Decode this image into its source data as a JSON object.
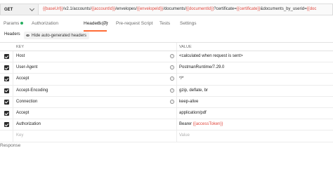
{
  "request": {
    "method": "GET",
    "url_parts": [
      {
        "text": "{{baseUrl}}",
        "var": true
      },
      {
        "text": "/v2.1/accounts/",
        "var": false
      },
      {
        "text": "{{accountId}}",
        "var": true
      },
      {
        "text": "/envelopes/",
        "var": false
      },
      {
        "text": "{{envelopeId}}",
        "var": true
      },
      {
        "text": "/documents/",
        "var": false
      },
      {
        "text": "{{documentId}}",
        "var": true
      },
      {
        "text": "?certificate=",
        "var": false
      },
      {
        "text": "{{certificate}}",
        "var": true
      },
      {
        "text": "&documents_by_userid=",
        "var": false
      },
      {
        "text": "{{doc",
        "var": true
      }
    ]
  },
  "tabs": [
    {
      "label": "Params",
      "dot": true
    },
    {
      "label": "Authorization"
    },
    {
      "label": "Headers (7)",
      "active": true
    },
    {
      "label": "Body"
    },
    {
      "label": "Pre-request Script"
    },
    {
      "label": "Tests"
    },
    {
      "label": "Settings"
    }
  ],
  "subbar": {
    "headers_label": "Headers",
    "hide_label": "Hide auto-generated headers"
  },
  "table": {
    "col_key": "KEY",
    "col_value": "VALUE",
    "rows": [
      {
        "key": "Host",
        "value_parts": [
          {
            "text": "<calculated when request is sent>"
          }
        ],
        "info": true
      },
      {
        "key": "User-Agent",
        "value_parts": [
          {
            "text": "PostmanRuntime/7.29.0"
          }
        ],
        "info": true
      },
      {
        "key": "Accept",
        "value_parts": [
          {
            "text": "*/*"
          }
        ],
        "info": true
      },
      {
        "key": "Accept-Encoding",
        "value_parts": [
          {
            "text": "gzip, deflate, br"
          }
        ],
        "info": true
      },
      {
        "key": "Connection",
        "value_parts": [
          {
            "text": "keep-alive"
          }
        ],
        "info": true
      },
      {
        "key": "Accept",
        "value_parts": [
          {
            "text": "application/pdf"
          }
        ],
        "info": false
      },
      {
        "key": "Authorization",
        "value_parts": [
          {
            "text": "Bearer "
          },
          {
            "text": "{{accessToken}}",
            "var": true
          }
        ],
        "info": false
      }
    ],
    "placeholder_key": "Key",
    "placeholder_value": "Value"
  },
  "response_label": "Response",
  "colors": {
    "accent": "#ff6c37",
    "variable": "#e0483e",
    "status_dot": "#27ae60"
  }
}
